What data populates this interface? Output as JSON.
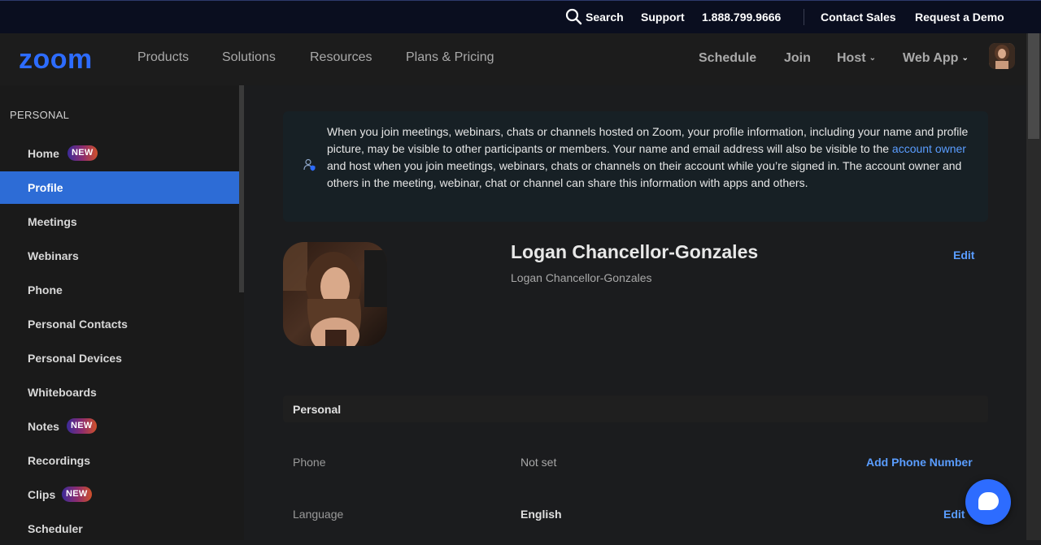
{
  "topbar": {
    "search_label": "Search",
    "support_label": "Support",
    "phone": "1.888.799.9666",
    "contact_sales": "Contact Sales",
    "request_demo": "Request a Demo"
  },
  "nav": {
    "logo": "zoom",
    "products": "Products",
    "solutions": "Solutions",
    "resources": "Resources",
    "plans_pricing": "Plans & Pricing",
    "schedule": "Schedule",
    "join": "Join",
    "host": "Host",
    "web_app": "Web App"
  },
  "sidebar": {
    "section_title": "PERSONAL",
    "items": [
      {
        "label": "Home",
        "badge": "NEW"
      },
      {
        "label": "Profile",
        "badge": ""
      },
      {
        "label": "Meetings",
        "badge": ""
      },
      {
        "label": "Webinars",
        "badge": ""
      },
      {
        "label": "Phone",
        "badge": ""
      },
      {
        "label": "Personal Contacts",
        "badge": ""
      },
      {
        "label": "Personal Devices",
        "badge": ""
      },
      {
        "label": "Whiteboards",
        "badge": ""
      },
      {
        "label": "Notes",
        "badge": "NEW"
      },
      {
        "label": "Recordings",
        "badge": ""
      },
      {
        "label": "Clips",
        "badge": "NEW"
      },
      {
        "label": "Scheduler",
        "badge": ""
      }
    ]
  },
  "notice": {
    "text_before": "When you join meetings, webinars, chats or channels hosted on Zoom, your profile information, including your name and profile picture, may be visible to other participants or members. Your name and email address will also be visible to the ",
    "link": "account owner",
    "text_after": " and host when you join meetings, webinars, chats or channels on their account while you’re signed in. The account owner and others in the meeting, webinar, chat or channel can share this information with apps and others."
  },
  "profile": {
    "display_name": "Logan Chancellor-Gonzales",
    "full_name": "Logan Chancellor-Gonzales",
    "edit_label": "Edit"
  },
  "personal_section": {
    "title": "Personal",
    "rows": [
      {
        "label": "Phone",
        "value": "Not set",
        "action": "Add Phone Number"
      },
      {
        "label": "Language",
        "value": "English",
        "action": "Edit"
      }
    ]
  },
  "colors": {
    "accent": "#2d6cff",
    "active_item": "#2d6cd6",
    "link": "#5a9dff"
  }
}
